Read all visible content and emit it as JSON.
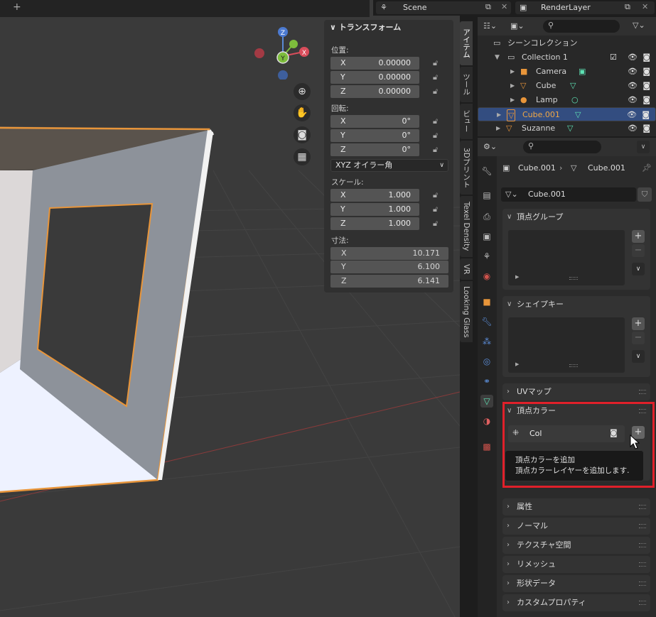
{
  "topbar": {
    "new_tab": "+"
  },
  "header": {
    "scene_name": "Scene",
    "render_layer": "RenderLayer"
  },
  "gizmo": {
    "z": "Z",
    "y": "Y",
    "x": "X"
  },
  "npanel": {
    "title": "トランスフォーム",
    "location": {
      "label": "位置:",
      "x_key": "X",
      "x": "0.00000",
      "y_key": "Y",
      "y": "0.00000",
      "z_key": "Z",
      "z": "0.00000"
    },
    "rotation": {
      "label": "回転:",
      "x_key": "X",
      "x": "0°",
      "y_key": "Y",
      "y": "0°",
      "z_key": "Z",
      "z": "0°",
      "mode": "XYZ オイラー角"
    },
    "scale": {
      "label": "スケール:",
      "x_key": "X",
      "x": "1.000",
      "y_key": "Y",
      "y": "1.000",
      "z_key": "Z",
      "z": "1.000"
    },
    "dimensions": {
      "label": "寸法:",
      "x_key": "X",
      "x": "10.171",
      "y_key": "Y",
      "y": "6.100",
      "z_key": "Z",
      "z": "6.141"
    }
  },
  "vtabs": [
    "アイテム",
    "ツール",
    "ビュー",
    "3Dプリント",
    "Texel Density",
    "VR",
    "Looking Glass"
  ],
  "outliner": {
    "root": "シーンコレクション",
    "collection": "Collection 1",
    "items": [
      "Camera",
      "Cube",
      "Lamp",
      "Cube.001",
      "Suzanne"
    ]
  },
  "properties": {
    "breadcrumb_object": "Cube.001",
    "breadcrumb_data": "Cube.001",
    "mesh_name": "Cube.001",
    "panels": {
      "vertex_groups": "頂点グループ",
      "shape_keys": "シェイプキー",
      "uv_maps": "UVマップ",
      "vertex_colors": "頂点カラー",
      "attributes": "属性",
      "normals": "ノーマル",
      "texture_space": "テクスチャ空間",
      "remesh": "リメッシュ",
      "geometry_data": "形状データ",
      "custom_props": "カスタムプロパティ"
    },
    "vertex_color_layer": "Col",
    "tooltip_title": "頂点カラーを追加",
    "tooltip_desc": "頂点カラーレイヤーを追加します."
  },
  "colors": {
    "highlight": "#e0202a",
    "selection": "#334d80",
    "object_orange": "#e8953a",
    "mesh_green": "#5ee2b4"
  }
}
